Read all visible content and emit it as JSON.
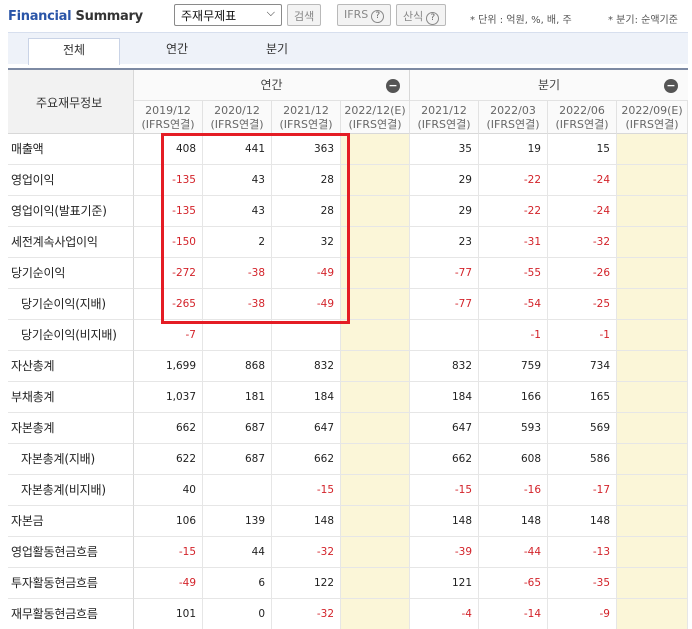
{
  "header": {
    "title_part1": "Financial",
    "title_part2": "Summary",
    "select_value": "주재무제표",
    "search_label": "검색",
    "ifrs_label": "IFRS",
    "formula_label": "산식",
    "help_glyph": "?",
    "unit_note": "* 단위 : 억원, %, 배, 주",
    "period_note": "* 분기: 순액기준"
  },
  "tabs": [
    {
      "label": "전체"
    },
    {
      "label": "연간"
    },
    {
      "label": "분기"
    }
  ],
  "table": {
    "corner_label": "주요재무정보",
    "group_annual": "연간",
    "group_quarter": "분기",
    "collapse_glyph": "−",
    "columns": [
      {
        "period": "2019/12",
        "basis": "(IFRS연결)"
      },
      {
        "period": "2020/12",
        "basis": "(IFRS연결)"
      },
      {
        "period": "2021/12",
        "basis": "(IFRS연결)"
      },
      {
        "period": "2022/12(E)",
        "basis": "(IFRS연결)"
      },
      {
        "period": "2021/12",
        "basis": "(IFRS연결)"
      },
      {
        "period": "2022/03",
        "basis": "(IFRS연결)"
      },
      {
        "period": "2022/06",
        "basis": "(IFRS연결)"
      },
      {
        "period": "2022/09(E)",
        "basis": "(IFRS연결)"
      }
    ],
    "rows": [
      {
        "label": "매출액",
        "sub": false,
        "values": [
          "408",
          "441",
          "363",
          "",
          "35",
          "19",
          "15",
          ""
        ]
      },
      {
        "label": "영업이익",
        "sub": false,
        "values": [
          "-135",
          "43",
          "28",
          "",
          "29",
          "-22",
          "-24",
          ""
        ]
      },
      {
        "label": "영업이익(발표기준)",
        "sub": false,
        "values": [
          "-135",
          "43",
          "28",
          "",
          "29",
          "-22",
          "-24",
          ""
        ]
      },
      {
        "label": "세전계속사업이익",
        "sub": false,
        "values": [
          "-150",
          "2",
          "32",
          "",
          "23",
          "-31",
          "-32",
          ""
        ]
      },
      {
        "label": "당기순이익",
        "sub": false,
        "values": [
          "-272",
          "-38",
          "-49",
          "",
          "-77",
          "-55",
          "-26",
          ""
        ]
      },
      {
        "label": "당기순이익(지배)",
        "sub": true,
        "values": [
          "-265",
          "-38",
          "-49",
          "",
          "-77",
          "-54",
          "-25",
          ""
        ]
      },
      {
        "label": "당기순이익(비지배)",
        "sub": true,
        "values": [
          "-7",
          "",
          "",
          "",
          "",
          "-1",
          "-1",
          ""
        ]
      },
      {
        "label": "자산총계",
        "sub": false,
        "values": [
          "1,699",
          "868",
          "832",
          "",
          "832",
          "759",
          "734",
          ""
        ]
      },
      {
        "label": "부채총계",
        "sub": false,
        "values": [
          "1,037",
          "181",
          "184",
          "",
          "184",
          "166",
          "165",
          ""
        ]
      },
      {
        "label": "자본총계",
        "sub": false,
        "values": [
          "662",
          "687",
          "647",
          "",
          "647",
          "593",
          "569",
          ""
        ]
      },
      {
        "label": "자본총계(지배)",
        "sub": true,
        "values": [
          "622",
          "687",
          "662",
          "",
          "662",
          "608",
          "586",
          ""
        ]
      },
      {
        "label": "자본총계(비지배)",
        "sub": true,
        "values": [
          "40",
          "",
          "-15",
          "",
          "-15",
          "-16",
          "-17",
          ""
        ]
      },
      {
        "label": "자본금",
        "sub": false,
        "values": [
          "106",
          "139",
          "148",
          "",
          "148",
          "148",
          "148",
          ""
        ]
      },
      {
        "label": "영업활동현금흐름",
        "sub": false,
        "values": [
          "-15",
          "44",
          "-32",
          "",
          "-39",
          "-44",
          "-13",
          ""
        ]
      },
      {
        "label": "투자활동현금흐름",
        "sub": false,
        "values": [
          "-49",
          "6",
          "122",
          "",
          "121",
          "-65",
          "-35",
          ""
        ]
      },
      {
        "label": "재무활동현금흐름",
        "sub": false,
        "values": [
          "101",
          "0",
          "-32",
          "",
          "-4",
          "-14",
          "-9",
          ""
        ]
      }
    ]
  },
  "colors": {
    "title_blue": "#2a55a8",
    "negative_red": "#d3232a",
    "estimate_bg": "#fbf6d8",
    "highlight_red": "#e41c24"
  }
}
